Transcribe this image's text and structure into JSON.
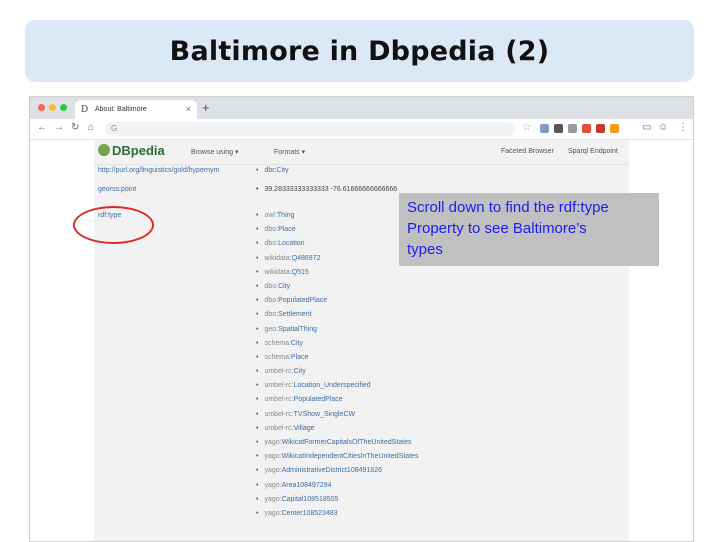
{
  "slide": {
    "title": "Baltimore in Dbpedia (2)"
  },
  "browser": {
    "tab_title": "About: Baltimore",
    "favicon": "D",
    "tab_close": "×",
    "new_tab": "+",
    "address": "G",
    "nav_icons": [
      "back-icon",
      "forward-icon",
      "reload-icon",
      "home-icon"
    ],
    "extension_colors": [
      "#7f9cc9",
      "#e74c3c",
      "#c0392b",
      "#f39c12",
      "#555555"
    ]
  },
  "dbpedia_header": {
    "logo": "DBpedia",
    "browse_using": "Browse using ▾",
    "formats": "Formats ▾",
    "faceted_browser": "Faceted Browser",
    "sparql_endpoint": "Sparql Endpoint"
  },
  "rows": {
    "prev_property": "http://purl.org/linguistics/gold/hypernym",
    "prev_value": "dbr:City",
    "georss_property": "georss:point",
    "georss_value": "39.28333333333333 -76.61666666666666",
    "rdf_type_property": "rdf:type"
  },
  "types": [
    {
      "prefix": "owl:",
      "name": "Thing"
    },
    {
      "prefix": "dbo:",
      "name": "Place"
    },
    {
      "prefix": "dbo:",
      "name": "Location"
    },
    {
      "prefix": "wikidata:",
      "name": "Q486972"
    },
    {
      "prefix": "wikidata:",
      "name": "Q515"
    },
    {
      "prefix": "dbo:",
      "name": "City"
    },
    {
      "prefix": "dbo:",
      "name": "PopulatedPlace"
    },
    {
      "prefix": "dbo:",
      "name": "Settlement"
    },
    {
      "prefix": "geo:",
      "name": "SpatialThing"
    },
    {
      "prefix": "schema:",
      "name": "City"
    },
    {
      "prefix": "schema:",
      "name": "Place"
    },
    {
      "prefix": "umbel-rc:",
      "name": "City"
    },
    {
      "prefix": "umbel-rc:",
      "name": "Location_Underspecified"
    },
    {
      "prefix": "umbel-rc:",
      "name": "PopulatedPlace"
    },
    {
      "prefix": "umbel-rc:",
      "name": "TVShow_SingleCW"
    },
    {
      "prefix": "umbel-rc:",
      "name": "Village"
    },
    {
      "prefix": "yago:",
      "name": "WikicatFormerCapitalsOfTheUnitedStates"
    },
    {
      "prefix": "yago:",
      "name": "WikicatIndependentCitiesInTheUnitedStates"
    },
    {
      "prefix": "yago:",
      "name": "AdministrativeDistrict108491826"
    },
    {
      "prefix": "yago:",
      "name": "Area108497294"
    },
    {
      "prefix": "yago:",
      "name": "Capital108518505"
    },
    {
      "prefix": "yago:",
      "name": "Center108523483"
    }
  ],
  "callout": {
    "line1": "Scroll down to find the rdf:type",
    "line2": "Property to see Baltimore’s",
    "line3": "types"
  },
  "colors": {
    "title_background": "#dbe9f6",
    "callout_background": "#c0c0c0",
    "callout_text": "#1d1df0",
    "highlight_circle": "#e02828",
    "link": "#3a6ea5"
  }
}
